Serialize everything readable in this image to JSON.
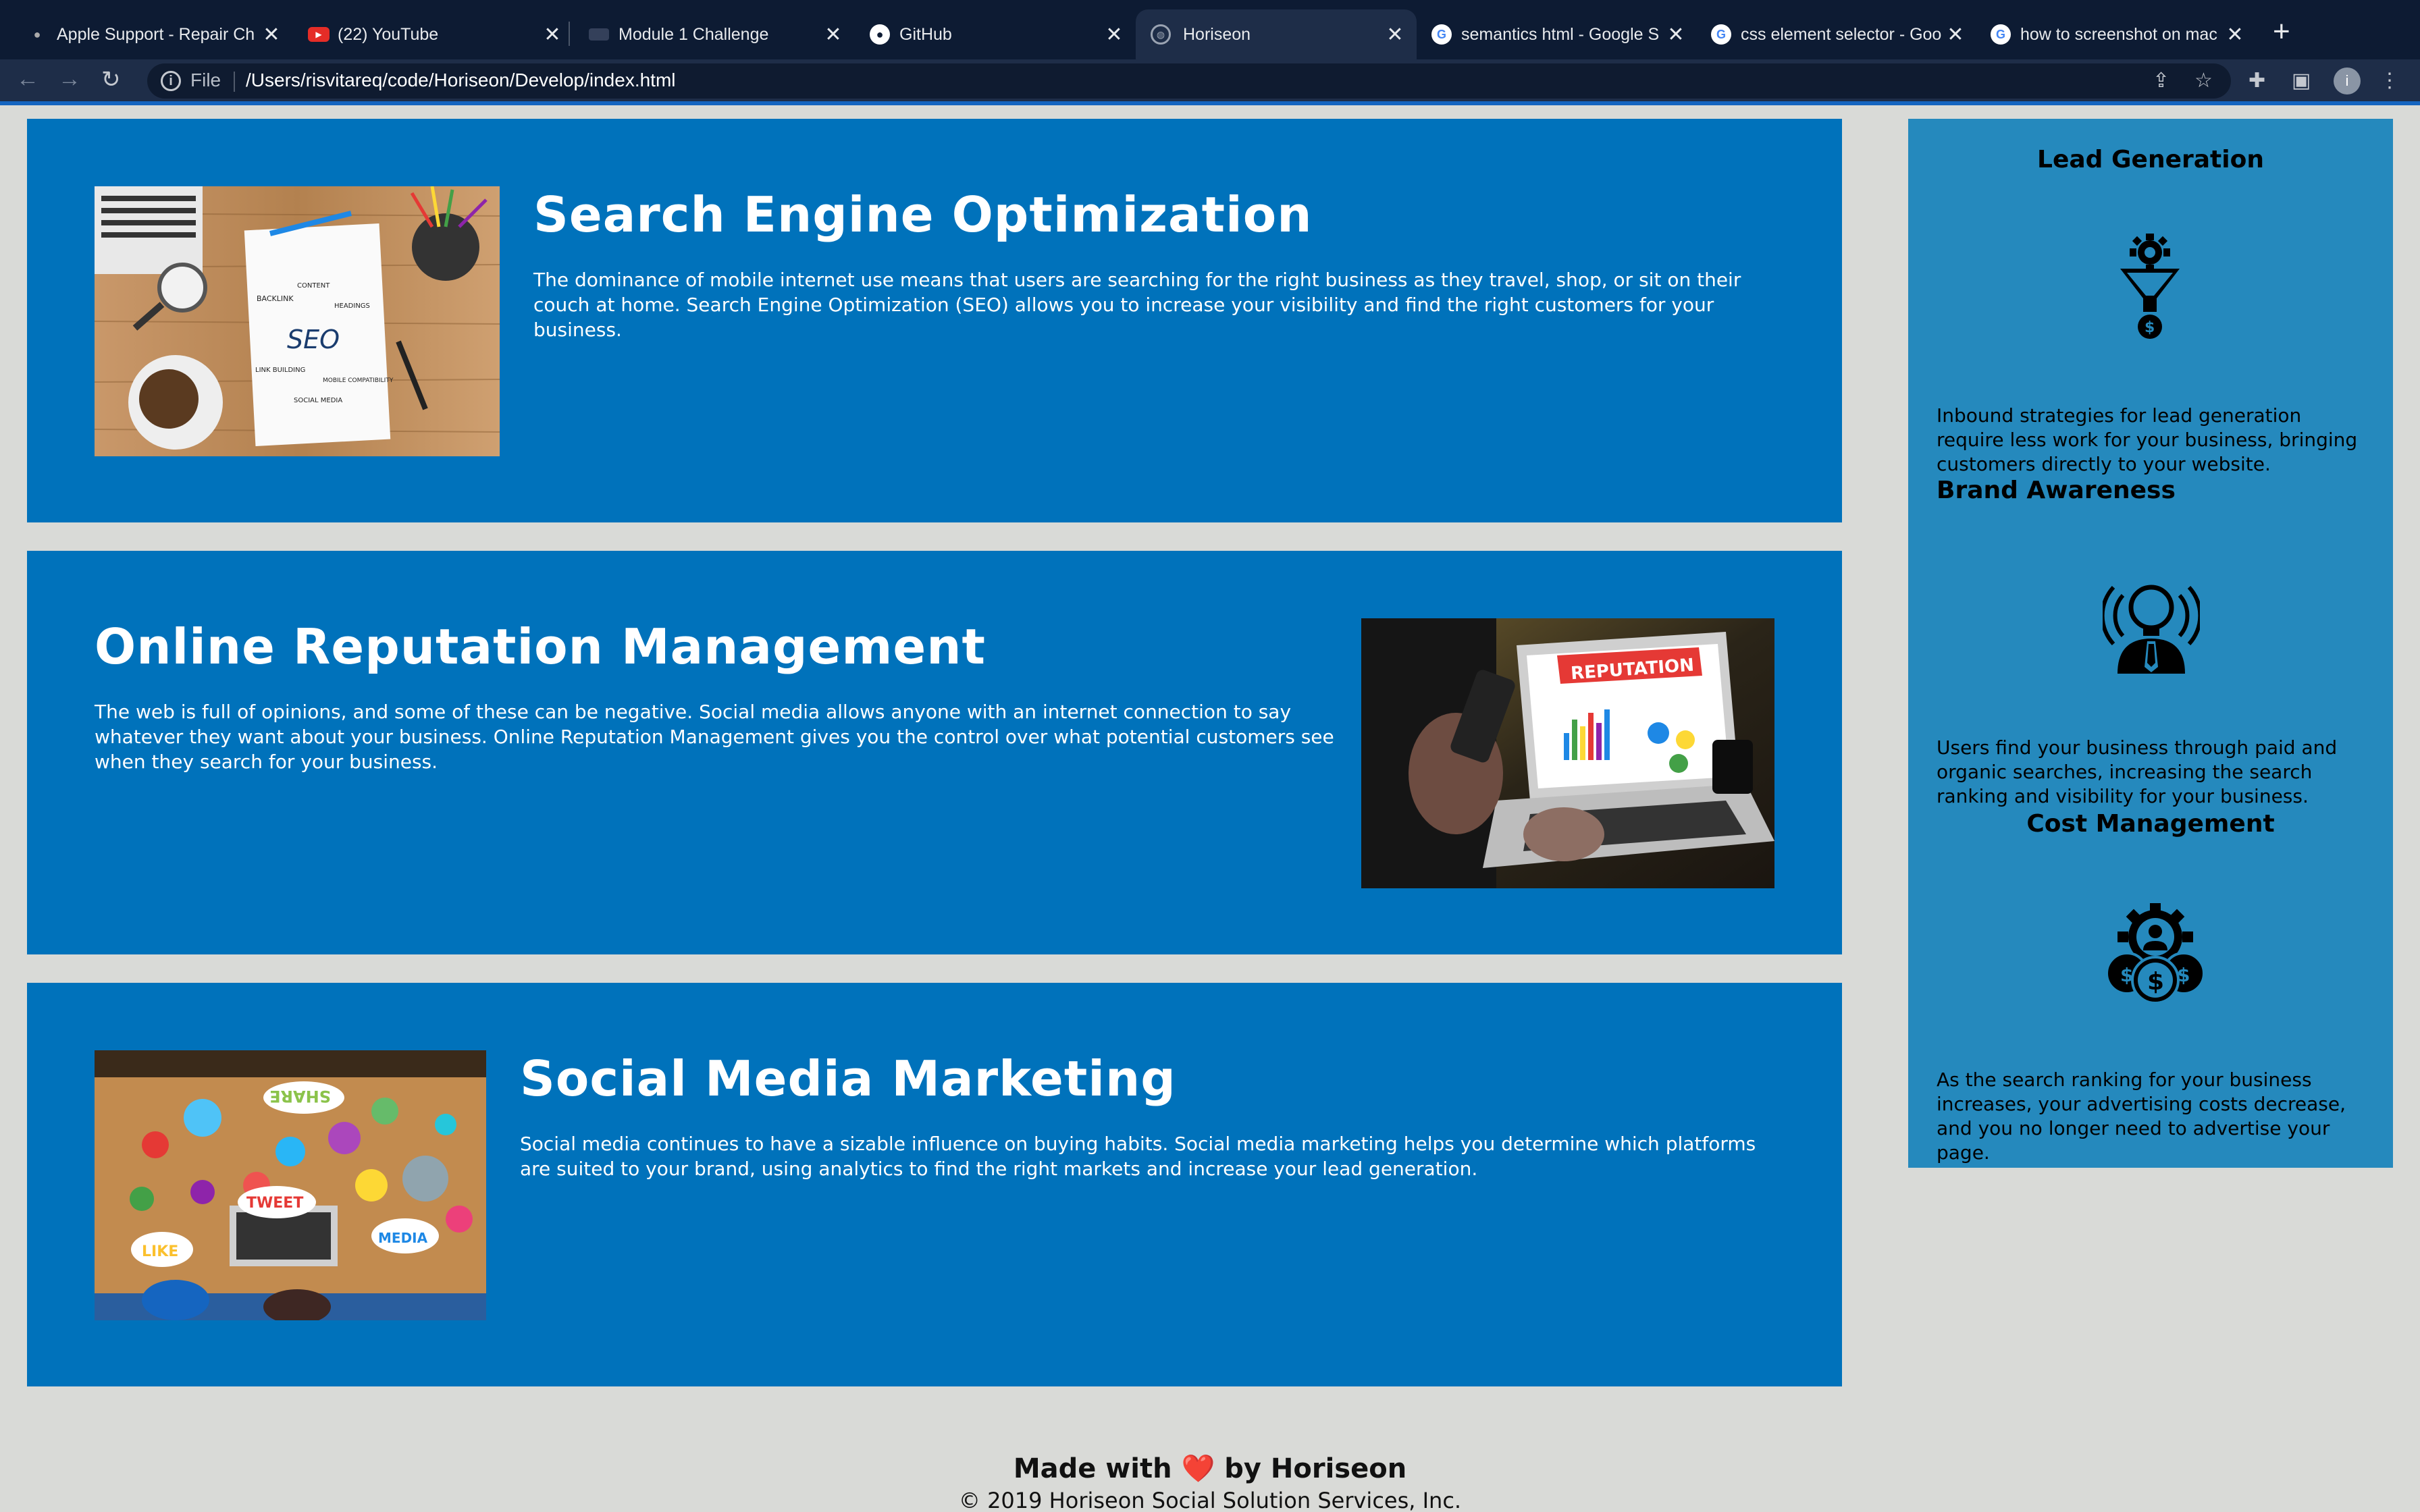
{
  "browser": {
    "tabs": [
      {
        "title": "Apple Support - Repair Ch",
        "icon": "apple-icon"
      },
      {
        "title": "(22) YouTube",
        "icon": "youtube-icon"
      },
      {
        "title": "Module 1 Challenge",
        "icon": "module-icon"
      },
      {
        "title": "GitHub",
        "icon": "github-icon"
      },
      {
        "title": "Horiseon",
        "icon": "globe-icon",
        "active": true
      },
      {
        "title": "semantics html - Google S",
        "icon": "google-icon"
      },
      {
        "title": "css element selector - Goo",
        "icon": "google-icon"
      },
      {
        "title": "how to screenshot on mac",
        "icon": "google-icon"
      }
    ],
    "close_glyph": "✕",
    "new_tab_glyph": "+",
    "address": {
      "scheme": "File",
      "url": "/Users/risvitareq/code/Horiseon/Develop/index.html"
    },
    "profile_initial": "i"
  },
  "content": [
    {
      "title": "Search Engine Optimization",
      "text": "The dominance of mobile internet use means that users are searching for the right business as they travel, shop, or sit on their couch at home. Search Engine Optimization (SEO) allows you to increase your visibility and find the right customers for your business.",
      "image_labels": [
        "SEO",
        "BACKLINK",
        "CONTENT",
        "HEADINGS",
        "LINK BUILDING",
        "MOBILE COMPATIBILITY",
        "SOCIAL MEDIA"
      ]
    },
    {
      "title": "Online Reputation Management",
      "text": "The web is full of opinions, and some of these can be negative. Social media allows anyone with an internet connection to say whatever they want about your business. Online Reputation Management gives you the control over what potential customers see when they search for your business.",
      "image_labels": [
        "REPUTATION"
      ]
    },
    {
      "title": "Social Media Marketing",
      "text": "Social media continues to have a sizable influence on buying habits. Social media marketing helps you determine which platforms are suited to your brand, using analytics to find the right markets and increase your lead generation.",
      "image_labels": [
        "SHARE",
        "TWEET",
        "LIKE",
        "MEDIA"
      ]
    }
  ],
  "benefits": [
    {
      "title": "Lead Generation",
      "text": "Inbound strategies for lead generation require less work for your business, bringing customers directly to your website.",
      "icon": "lead-funnel-icon"
    },
    {
      "title": "Brand Awareness",
      "text": "Users find your business through paid and organic searches, increasing the search ranking and visibility for your business.",
      "icon": "lightbulb-person-icon"
    },
    {
      "title": "Cost Management",
      "text": "As the search ranking for your business increases, your advertising costs decrease, and you no longer need to advertise your page.",
      "icon": "cost-gear-coins-icon"
    }
  ],
  "footer": {
    "made_with_prefix": "Made with",
    "heart": "❤️",
    "made_with_suffix": "by Horiseon",
    "copyright": "© 2019 Horiseon Social Solution Services, Inc."
  },
  "colors": {
    "card": "#0072bb",
    "aside": "#2589bd",
    "page_bg": "#d9dad7"
  }
}
